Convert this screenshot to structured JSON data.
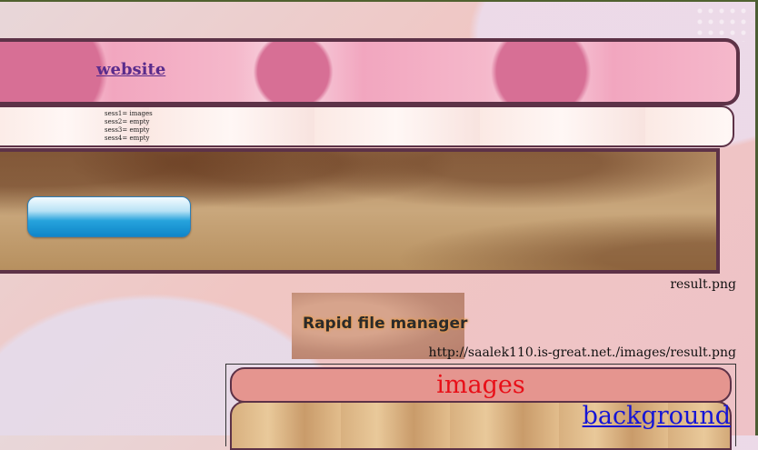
{
  "header": {
    "website_link": "website"
  },
  "sessions": [
    "sess1= images",
    "sess2= empty",
    "sess3= empty",
    "sess4= empty"
  ],
  "result": {
    "filename": "result.png",
    "image_text": "Rapid file manager",
    "url": "http://saalek110.is-great.net./images/result.png"
  },
  "bottom": {
    "title": "images",
    "background_link": "background"
  },
  "colors": {
    "frame": "#5d3247",
    "title_red": "#e80f18",
    "link_blue": "#1515d6"
  }
}
